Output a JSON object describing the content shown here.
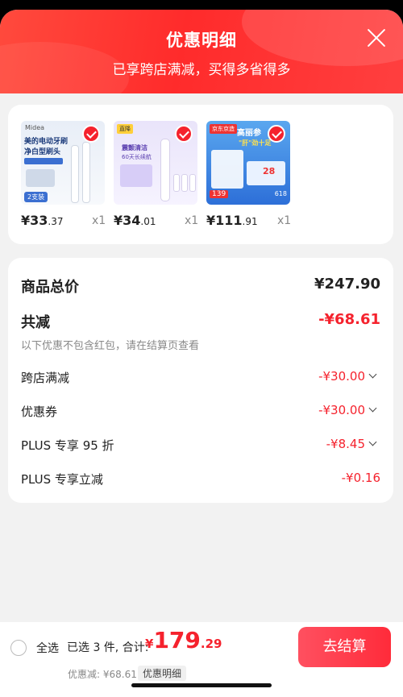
{
  "header": {
    "title": "优惠明细",
    "subtitle": "已享跨店满减，买得多省得多",
    "close_icon": "close-icon"
  },
  "products": [
    {
      "price_main": "¥33",
      "price_decimal": ".37",
      "qty": "x1",
      "thumb_text": [
        "Midea",
        "美的电动牙刷",
        "净白型刷头",
        "2支装"
      ]
    },
    {
      "price_main": "¥34",
      "price_decimal": ".01",
      "qty": "x1",
      "thumb_text": [
        "直降",
        "震颤清洁",
        "60天长续航"
      ]
    },
    {
      "price_main": "¥111",
      "price_decimal": ".91",
      "qty": "x1",
      "thumb_text": [
        "京东京造",
        "高丽参",
        "\"肝\"劲十足",
        "139",
        "28",
        "618"
      ]
    }
  ],
  "summary": {
    "total_label": "商品总价",
    "total_value": "¥247.90",
    "reduce_label": "共减",
    "reduce_value": "-¥68.61",
    "note": "以下优惠不包含红包，请在结算页查看",
    "items": [
      {
        "label": "跨店满减",
        "value": "-¥30.00",
        "expandable": true
      },
      {
        "label": "优惠券",
        "value": "-¥30.00",
        "expandable": true
      },
      {
        "label": "PLUS 专享 95 折",
        "value": "-¥8.45",
        "expandable": true
      },
      {
        "label": "PLUS 专享立减",
        "value": "-¥0.16",
        "expandable": false
      }
    ]
  },
  "footer": {
    "select_all": "全选",
    "selected_text": "已选 3 件, 合计:",
    "currency": "¥",
    "amount_main": "179",
    "amount_decimal": ".29",
    "discount_text": "优惠减: ¥68.61",
    "detail_tag": "优惠明细",
    "checkout_label": "去结算"
  },
  "colors": {
    "accent": "#f5222d",
    "header": "#ff2b2b"
  }
}
